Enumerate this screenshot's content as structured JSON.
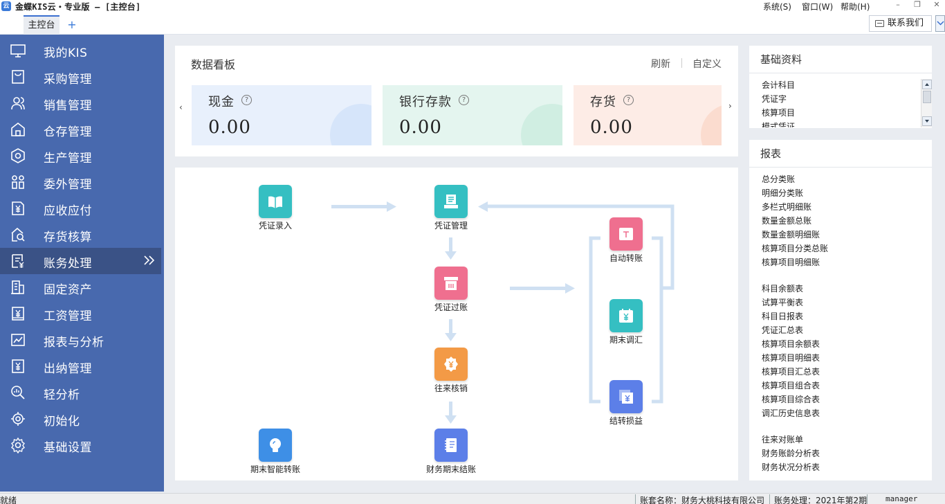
{
  "window": {
    "title": "金蝶KIS云・专业版 – [主控台]",
    "logo": "云",
    "menus": [
      "系统(S)",
      "窗口(W)",
      "帮助(H)"
    ],
    "controls": [
      "–",
      "❐",
      "✕"
    ]
  },
  "tabs": {
    "home": "主控台",
    "add": "+",
    "contact": "联系我们"
  },
  "sidebar": {
    "items": [
      {
        "label": "我的KIS",
        "icon": "monitor-icon"
      },
      {
        "label": "采购管理",
        "icon": "purchase-bag-icon"
      },
      {
        "label": "销售管理",
        "icon": "sales-users-icon"
      },
      {
        "label": "仓存管理",
        "icon": "warehouse-icon"
      },
      {
        "label": "生产管理",
        "icon": "production-hexagon-icon"
      },
      {
        "label": "委外管理",
        "icon": "outsource-icon"
      },
      {
        "label": "应收应付",
        "icon": "receivable-yen-icon"
      },
      {
        "label": "存货核算",
        "icon": "inventory-search-icon"
      },
      {
        "label": "账务处理",
        "icon": "accounting-doc-icon",
        "active": true
      },
      {
        "label": "固定资产",
        "icon": "fixed-asset-building-icon"
      },
      {
        "label": "工资管理",
        "icon": "salary-icon"
      },
      {
        "label": "报表与分析",
        "icon": "report-chart-icon"
      },
      {
        "label": "出纳管理",
        "icon": "cashier-yen-icon"
      },
      {
        "label": "轻分析",
        "icon": "analysis-magnifier-icon"
      },
      {
        "label": "初始化",
        "icon": "init-target-icon"
      },
      {
        "label": "基础设置",
        "icon": "settings-gear-icon"
      }
    ]
  },
  "board": {
    "title": "数据看板",
    "refresh": "刷新",
    "customize": "自定义",
    "cards": [
      {
        "label": "现金",
        "value": "0.00",
        "bg": "#e8f0fc",
        "deco": "#d6e5fa"
      },
      {
        "label": "银行存款",
        "value": "0.00",
        "bg": "#e4f5ef",
        "deco": "#d0eee2"
      },
      {
        "label": "存货",
        "value": "0.00",
        "bg": "#fdece6",
        "deco": "#fbdccf"
      }
    ]
  },
  "flow": {
    "nodes": [
      {
        "id": "voucher-entry",
        "label": "凭证录入",
        "color": "#35bfc2"
      },
      {
        "id": "voucher-manage",
        "label": "凭证管理",
        "color": "#35bfc2"
      },
      {
        "id": "voucher-post",
        "label": "凭证过账",
        "color": "#ef6f8f"
      },
      {
        "id": "writeoff",
        "label": "往来核销",
        "color": "#f39a46"
      },
      {
        "id": "period-close",
        "label": "财务期末结账",
        "color": "#5c7fe8"
      },
      {
        "id": "smart-transfer",
        "label": "期末智能转账",
        "color": "#3e8fe6"
      },
      {
        "id": "auto-transfer",
        "label": "自动转账",
        "color": "#ef6f8f"
      },
      {
        "id": "fx-adjust",
        "label": "期末调汇",
        "color": "#35bfc2"
      },
      {
        "id": "carry-pl",
        "label": "结转损益",
        "color": "#5c7fe8"
      }
    ]
  },
  "basic_panel": {
    "title": "基础资料",
    "items": [
      "会计科目",
      "凭证字",
      "核算项目",
      "模式凭证"
    ]
  },
  "report_panel": {
    "title": "报表",
    "groups": [
      [
        "总分类账",
        "明细分类账",
        "多栏式明细账",
        "数量金额总账",
        "数量金额明细账",
        "核算项目分类总账",
        "核算项目明细账"
      ],
      [
        "科目余额表",
        "试算平衡表",
        "科目日报表",
        "凭证汇总表",
        "核算项目余额表",
        "核算项目明细表",
        "核算项目汇总表",
        "核算项目组合表",
        "核算项目综合表",
        "调汇历史信息表"
      ],
      [
        "往来对账单",
        "财务账龄分析表",
        "财务状况分析表"
      ]
    ]
  },
  "status": {
    "ready": "就绪",
    "company": "账套名称：财务大桃科技有限公司",
    "period": "账务处理：2021年第2期",
    "user": "manager"
  }
}
